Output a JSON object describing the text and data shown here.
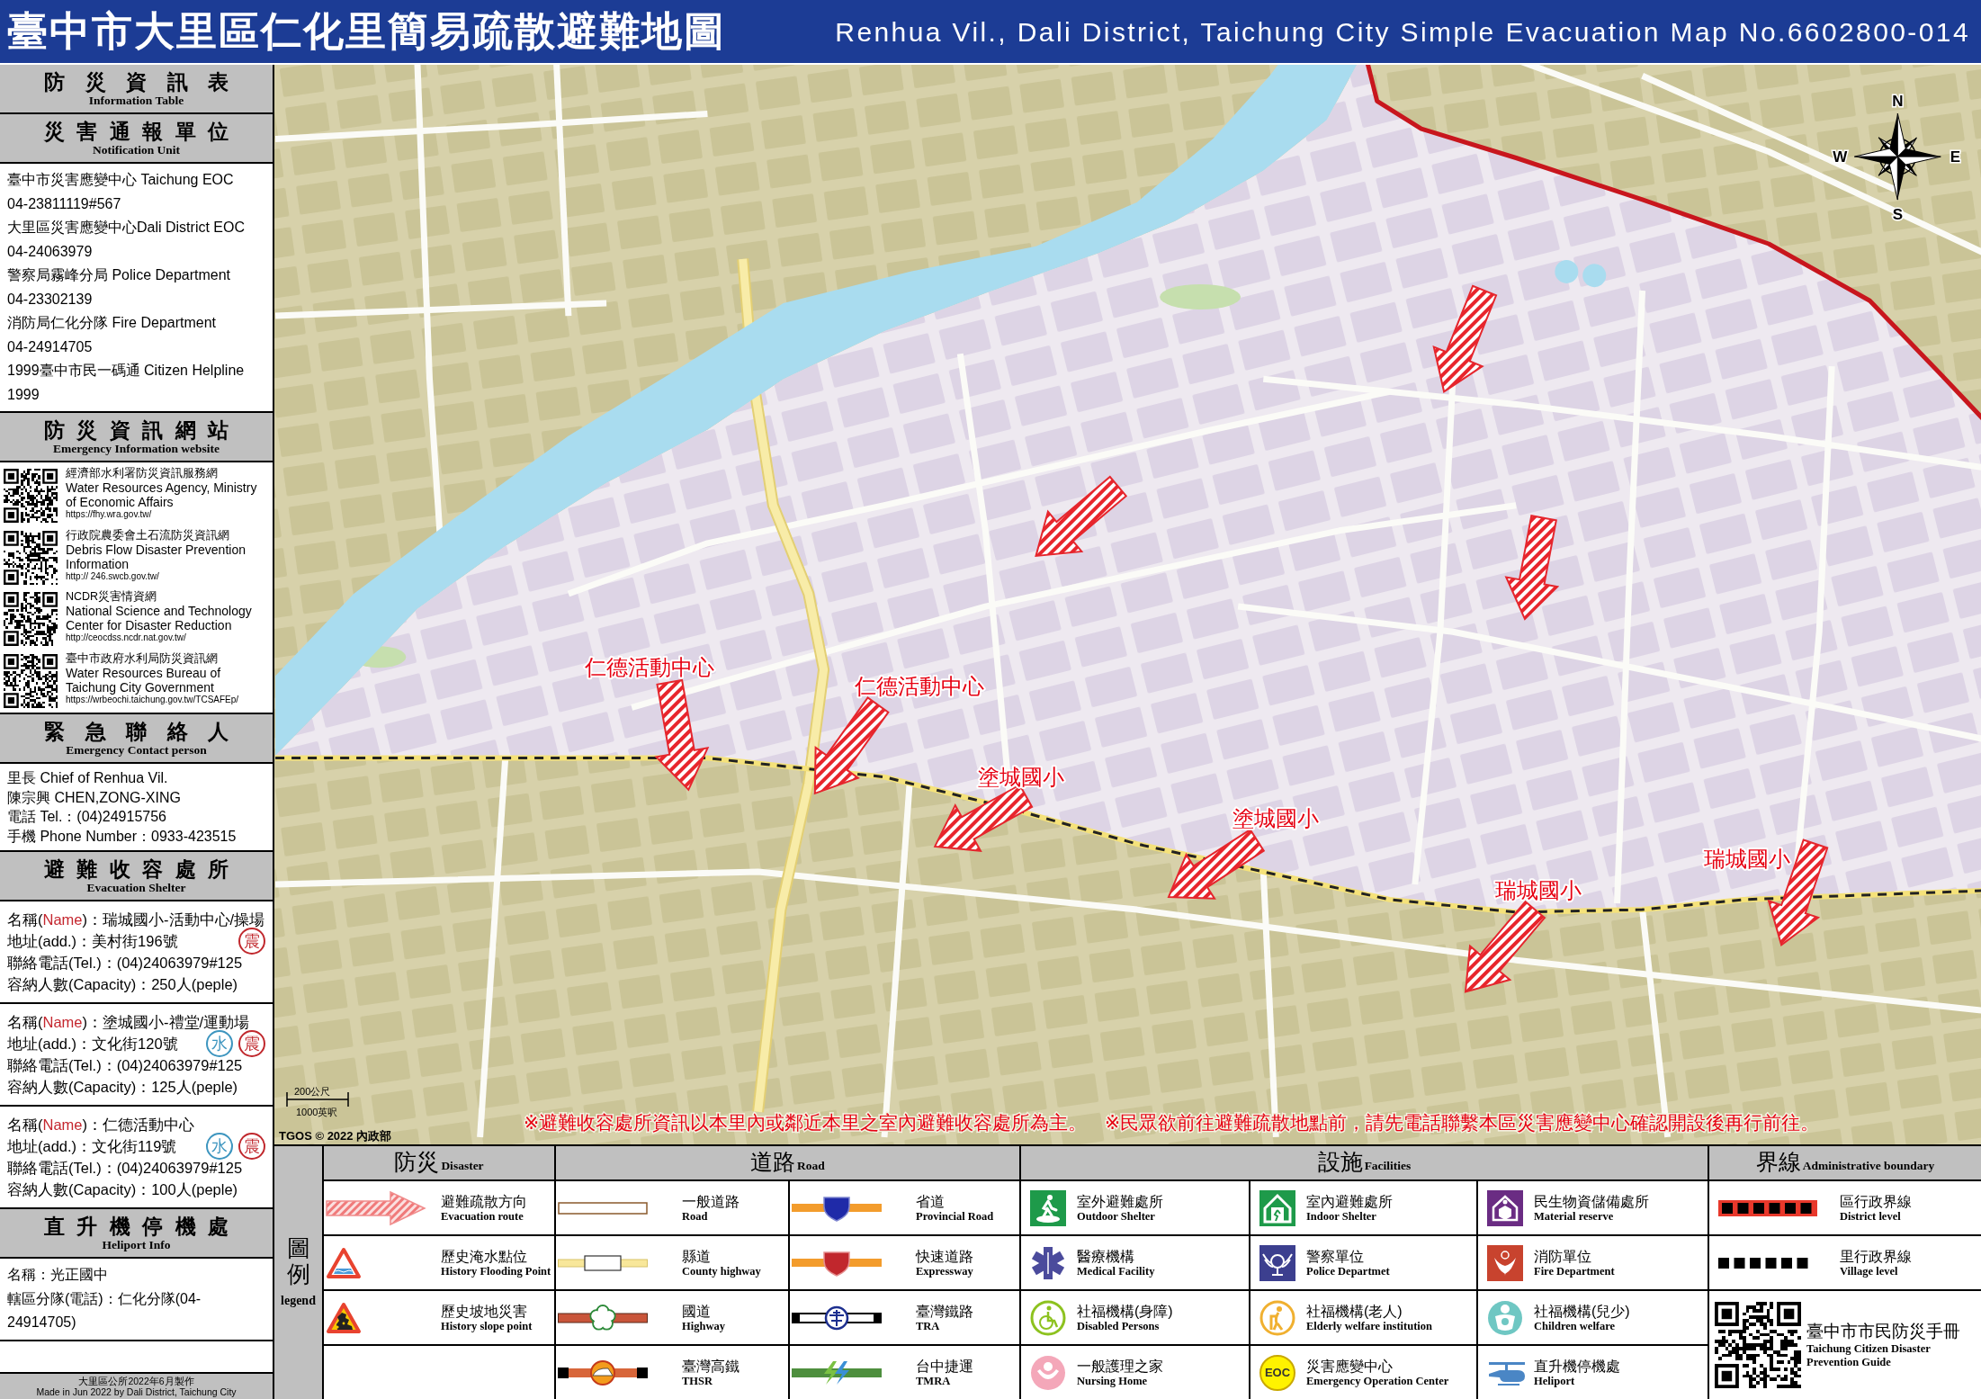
{
  "title_bar": {
    "title": "臺中市大里區仁化里簡易疏散避難地圖",
    "title_en": "Renhua Vil., Dali District, Taichung City Simple Evacuation Map No.6602800-014"
  },
  "sidebar": {
    "sections": [
      {
        "kind": "heading",
        "title": "防災資訊表",
        "subtitle": "Information Table"
      },
      {
        "kind": "lines",
        "title": "災害通報單位",
        "subtitle": "Notification Unit",
        "lines": [
          "臺中市災害應變中心 Taichung EOC",
          "04-23811119#567",
          "大里區災害應變中心Dali District EOC",
          "04-24063979",
          "警察局霧峰分局 Police Department",
          "04-23302139",
          "消防局仁化分隊 Fire Department",
          "04-24914705",
          "1999臺中市民一碼通 Citizen Helpline",
          "1999"
        ]
      },
      {
        "kind": "websites",
        "title": "防災資訊網站",
        "subtitle": "Emergency Information website",
        "items": [
          {
            "name": "經濟部水利署防災資訊服務網",
            "name_en": "Water Resources Agency, Ministry of Economic Affairs",
            "url": "https://fhy.wra.gov.tw/"
          },
          {
            "name": "行政院農委會土石流防災資訊網",
            "name_en": "Debris Flow Disaster Prevention Information",
            "url": "http:// 246.swcb.gov.tw/"
          },
          {
            "name": "NCDR災害情資網",
            "name_en": "National Science and Technology Center for Disaster Reduction",
            "url": "http://ceocdss.ncdr.nat.gov.tw/"
          },
          {
            "name": "臺中市政府水利局防災資訊網",
            "name_en": "Water Resources Bureau of Taichung City Government",
            "url": "https://wrbeochi.taichung.gov.tw/TCSAFEp/"
          }
        ]
      },
      {
        "kind": "lines",
        "title": "緊急聯絡人",
        "subtitle": "Emergency Contact person",
        "lines": [
          "里長 Chief of Renhua Vil.",
          "陳宗興 CHEN,ZONG-XING",
          "電話 Tel.：(04)24915756",
          "手機 Phone Number：0933-423515"
        ]
      },
      {
        "kind": "shelters",
        "title": "避難收容處所",
        "subtitle": "Evacuation Shelter",
        "items": [
          {
            "name": {
              "before": "名稱(",
              "accent": "Name",
              "after": ")：瑞城國小-活動中心/操場"
            },
            "address": "地址(add.)：美村街196號",
            "tel": "聯絡電話(Tel.)：(04)24063979#125",
            "capacity": "容納人數(Capacity)：250人(peple)",
            "hazards": [
              {
                "kind": "earthquake",
                "label": "震"
              }
            ]
          },
          {
            "name": {
              "before": "名稱(",
              "accent": "Name",
              "after": ")：塗城國小-禮堂/運動場"
            },
            "address": "地址(add.)：文化街120號",
            "tel": "聯絡電話(Tel.)：(04)24063979#125",
            "capacity": "容納人數(Capacity)：125人(peple)",
            "hazards": [
              {
                "kind": "flood",
                "label": "水"
              },
              {
                "kind": "earthquake",
                "label": "震"
              }
            ]
          },
          {
            "name": {
              "before": "名稱(",
              "accent": "Name",
              "after": ")：仁德活動中心"
            },
            "address": "地址(add.)：文化街119號",
            "tel": "聯絡電話(Tel.)：(04)24063979#125",
            "capacity": "容納人數(Capacity)：100人(peple)",
            "hazards": [
              {
                "kind": "flood",
                "label": "水"
              },
              {
                "kind": "earthquake",
                "label": "震"
              }
            ]
          }
        ]
      },
      {
        "kind": "lines",
        "title": "直升機停機處",
        "subtitle": "Heliport Info",
        "lines": [
          "名稱：光正國中",
          "轄區分隊(電話)：仁化分隊(04-24914705)"
        ]
      }
    ],
    "footer": [
      "大里區公所2022年6月製作",
      "Made in Jun 2022 by Dali District, Taichung City"
    ]
  },
  "map": {
    "shelter_labels": [
      "仁德活動中心",
      "仁德活動中心",
      "塗城國小",
      "塗城國小",
      "瑞城國小",
      "瑞城國小"
    ],
    "compass": {
      "north": "N",
      "east": "E",
      "south": "S",
      "west": "W"
    },
    "scale": {
      "metric": "200公尺",
      "imperial": "1000英呎"
    },
    "notices": [
      "※避難收容處所資訊以本里內或鄰近本里之室內避難收容處所為主。",
      "※民眾欲前往避難疏散地點前，請先電話聯繫本區災害應變中心確認開設後再行前往。"
    ],
    "credit": "TGOS © 2022 內政部"
  },
  "legend": {
    "title": "圖例",
    "title_en": "legend",
    "groups": [
      {
        "title": "防災",
        "title_en": "Disaster",
        "columns": [
          [
            {
              "kind": "evacuation-route",
              "label": "避難疏散方向",
              "label_en": "Evacuation route"
            },
            {
              "kind": "flooding-point",
              "label": "歷史淹水點位",
              "label_en": "History Flooding Point"
            },
            {
              "kind": "slope-point",
              "label": "歷史坡地災害",
              "label_en": "History slope point"
            }
          ]
        ]
      },
      {
        "title": "道路",
        "title_en": "Road",
        "columns": [
          [
            {
              "kind": "road",
              "label": "一般道路",
              "label_en": "Road"
            },
            {
              "kind": "county-highway",
              "label": "縣道",
              "label_en": "County highway"
            },
            {
              "kind": "highway",
              "label": "國道",
              "label_en": "Highway"
            },
            {
              "kind": "thsr",
              "label": "臺灣高鐵",
              "label_en": "THSR"
            }
          ],
          [
            {
              "kind": "provincial-road",
              "label": "省道",
              "label_en": "Provincial Road"
            },
            {
              "kind": "expressway",
              "label": "快速道路",
              "label_en": "Expressway"
            },
            {
              "kind": "tra",
              "label": "臺灣鐵路",
              "label_en": "TRA"
            },
            {
              "kind": "tmra",
              "label": "台中捷運",
              "label_en": "TMRA"
            }
          ]
        ]
      },
      {
        "title": "設施",
        "title_en": "Facilities",
        "columns": [
          [
            {
              "kind": "outdoor-shelter",
              "label": "室外避難處所",
              "label_en": "Outdoor Shelter"
            },
            {
              "kind": "medical",
              "label": "醫療機構",
              "label_en": "Medical Facility"
            },
            {
              "kind": "disabled",
              "label": "社福機構(身障)",
              "label_en": "Disabled Persons"
            },
            {
              "kind": "nursing",
              "label": "一般護理之家",
              "label_en": "Nursing Home"
            }
          ],
          [
            {
              "kind": "indoor-shelter",
              "label": "室內避難處所",
              "label_en": "Indoor Shelter"
            },
            {
              "kind": "police",
              "label": "警察單位",
              "label_en": "Police Departmet"
            },
            {
              "kind": "elderly",
              "label": "社福機構(老人)",
              "label_en": "Elderly welfare institution"
            },
            {
              "kind": "eoc",
              "icon_text": "EOC",
              "label": "災害應變中心",
              "label_en": "Emergency Operation Center"
            }
          ],
          [
            {
              "kind": "material",
              "label": "民生物資儲備處所",
              "label_en": "Material reserve"
            },
            {
              "kind": "fire",
              "label": "消防單位",
              "label_en": "Fire Department"
            },
            {
              "kind": "children",
              "label": "社福機構(兒少)",
              "label_en": "Children welfare"
            },
            {
              "kind": "heliport",
              "label": "直升機停機處",
              "label_en": "Heliport"
            }
          ]
        ]
      },
      {
        "title": "界線",
        "title_en": "Administrative boundary",
        "columns": [
          [
            {
              "kind": "district",
              "label": "區行政界線",
              "label_en": "District level"
            },
            {
              "kind": "village",
              "label": "里行政界線",
              "label_en": "Village level"
            },
            {
              "kind": "qr-guide",
              "label": "臺中市市民防災手冊",
              "label_en": "Taichung Citizen Disaster Prevention Guide"
            }
          ]
        ]
      }
    ]
  }
}
